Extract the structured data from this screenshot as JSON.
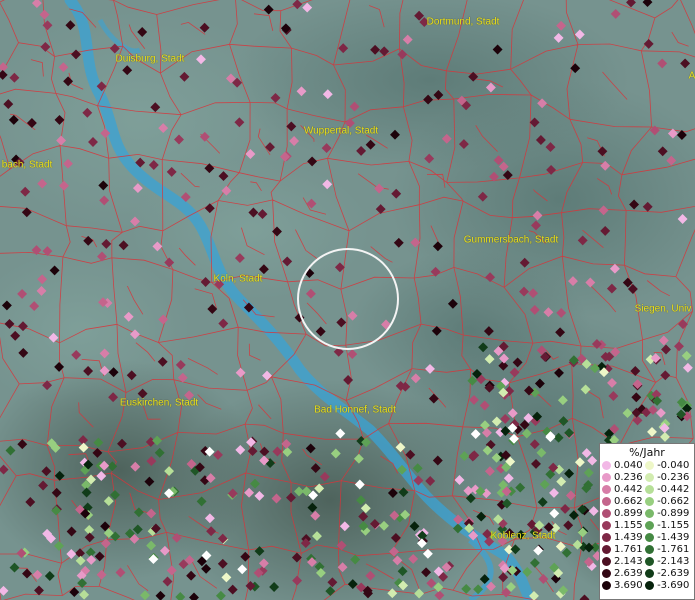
{
  "cities": [
    {
      "label": "Dortmund, Stadt"
    },
    {
      "label": "Duisburg, Stadt"
    },
    {
      "label": "Wuppertal, Stadt"
    },
    {
      "label": "bach, Stadt"
    },
    {
      "label": "Gummersbach, Stadt"
    },
    {
      "label": "Köln, Stadt"
    },
    {
      "label": "Siegen, Univ"
    },
    {
      "label": "Euskirchen, Stadt"
    },
    {
      "label": "Bad Honnef, Stadt"
    },
    {
      "label": "Koblenz, Stadt"
    },
    {
      "label": "A"
    }
  ],
  "legend": {
    "title": "%/Jahr",
    "positive": [
      {
        "value": "0.040",
        "color": "#f2b8e6"
      },
      {
        "value": "0.236",
        "color": "#e89ac8"
      },
      {
        "value": "0.442",
        "color": "#d77ea8"
      },
      {
        "value": "0.662",
        "color": "#c4658c"
      },
      {
        "value": "0.899",
        "color": "#b04f74"
      },
      {
        "value": "1.155",
        "color": "#983a5c"
      },
      {
        "value": "1.439",
        "color": "#7e2846"
      },
      {
        "value": "1.761",
        "color": "#641a33"
      },
      {
        "value": "2.143",
        "color": "#4c0f22"
      },
      {
        "value": "2.639",
        "color": "#340714"
      },
      {
        "value": "3.690",
        "color": "#1c020a"
      }
    ],
    "negative": [
      {
        "value": "-0.040",
        "color": "#eef7c8"
      },
      {
        "value": "-0.236",
        "color": "#d2ecb0"
      },
      {
        "value": "-0.442",
        "color": "#b6df98"
      },
      {
        "value": "-0.662",
        "color": "#98cf80"
      },
      {
        "value": "-0.899",
        "color": "#7ab96a"
      },
      {
        "value": "-1.155",
        "color": "#5ea256"
      },
      {
        "value": "-1.439",
        "color": "#468a44"
      },
      {
        "value": "-1.761",
        "color": "#317034"
      },
      {
        "value": "-2.143",
        "color": "#1f5626"
      },
      {
        "value": "-2.639",
        "color": "#113c19"
      },
      {
        "value": "-3.690",
        "color": "#06220c"
      }
    ]
  }
}
